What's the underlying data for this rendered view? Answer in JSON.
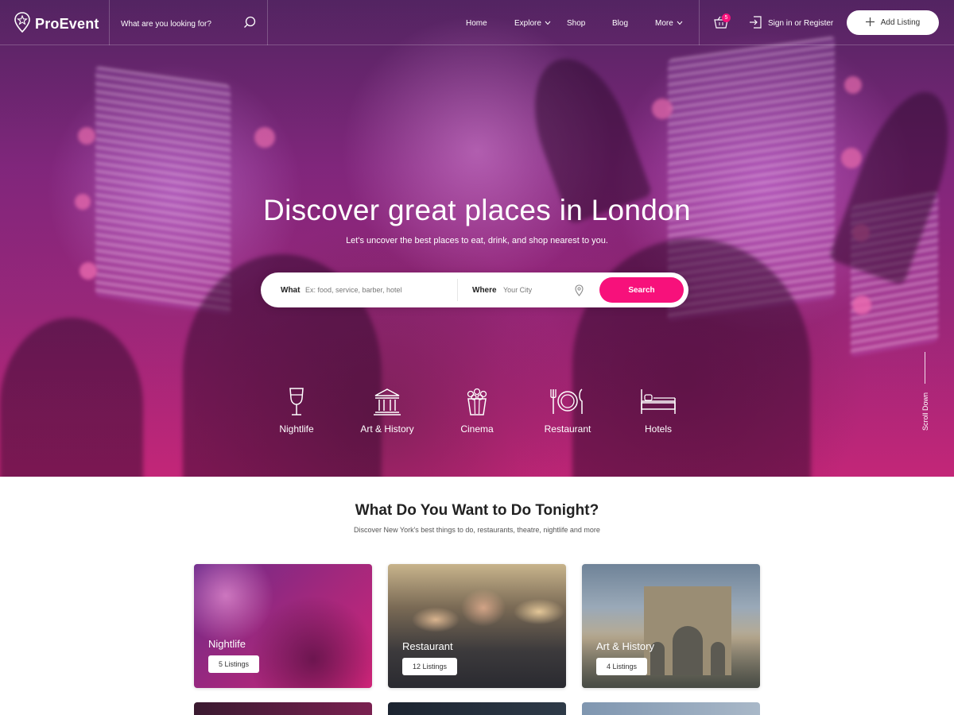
{
  "brand": {
    "name": "ProEvent"
  },
  "nav": {
    "search_placeholder": "What are you looking for?",
    "items": [
      {
        "label": "Home",
        "has_dropdown": false
      },
      {
        "label": "Explore",
        "has_dropdown": true
      },
      {
        "label": "Shop",
        "has_dropdown": false
      },
      {
        "label": "Blog",
        "has_dropdown": false
      },
      {
        "label": "More",
        "has_dropdown": true
      }
    ],
    "cart_count": "5",
    "signin_label": "Sign in or Register",
    "add_listing_label": "Add Listing"
  },
  "hero": {
    "title": "Discover great places in London",
    "subtitle": "Let's uncover the best places to eat, drink, and shop nearest to you.",
    "search": {
      "what_label": "What",
      "what_placeholder": "Ex: food, service, barber, hotel",
      "where_label": "Where",
      "where_placeholder": "Your City",
      "button_label": "Search"
    },
    "categories": [
      {
        "label": "Nightlife",
        "icon": "wine-glass-icon"
      },
      {
        "label": "Art & History",
        "icon": "museum-icon"
      },
      {
        "label": "Cinema",
        "icon": "popcorn-icon"
      },
      {
        "label": "Restaurant",
        "icon": "plate-cutlery-icon"
      },
      {
        "label": "Hotels",
        "icon": "bed-icon"
      }
    ],
    "scroll_label": "Scroll Down"
  },
  "section": {
    "title": "What Do You Want to Do Tonight?",
    "subtitle": "Discover New York's best things to do, restaurants, theatre, nightlife and more",
    "cards": [
      {
        "title": "Nightlife",
        "badge": "5 Listings"
      },
      {
        "title": "Restaurant",
        "badge": "12 Listings"
      },
      {
        "title": "Art & History",
        "badge": "4 Listings"
      }
    ]
  },
  "colors": {
    "accent": "#f7117b",
    "text_dark": "#222222"
  }
}
